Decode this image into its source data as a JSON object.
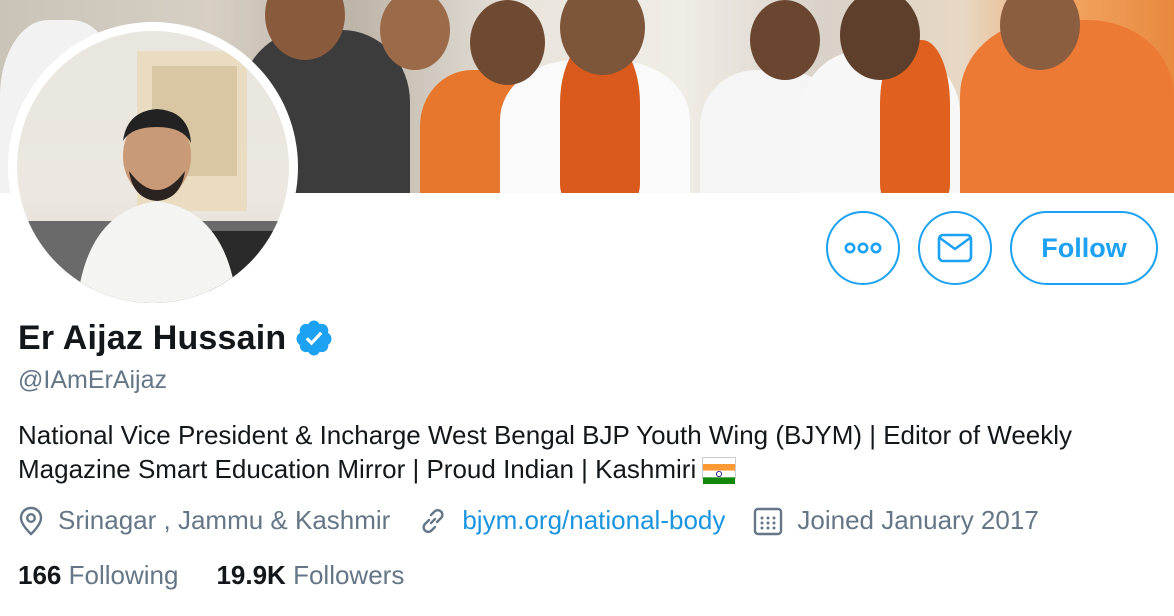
{
  "profile": {
    "name": "Er Aijaz Hussain",
    "handle": "@IAmErAijaz",
    "bio": "National Vice President & Incharge West Bengal BJP Youth Wing (BJYM) | Editor of Weekly Magazine Smart Education Mirror | Proud Indian | Kashmiri",
    "location": "Srinagar , Jammu & Kashmir",
    "website": "bjym.org/national-body",
    "joined": "Joined January 2017"
  },
  "actions": {
    "more_icon": "more-horizontal-icon",
    "message_icon": "envelope-icon",
    "follow_label": "Follow"
  },
  "stats": {
    "following_count": "166",
    "following_label": "Following",
    "followers_count": "19.9K",
    "followers_label": "Followers"
  },
  "icons": {
    "verified": "verified-badge-icon",
    "location": "location-pin-icon",
    "link": "link-icon",
    "calendar": "calendar-icon",
    "flag": "india-flag-emoji"
  },
  "colors": {
    "accent": "#1da1f2",
    "link": "#1b95e0",
    "secondary_text": "#657786",
    "primary_text": "#14171a"
  }
}
